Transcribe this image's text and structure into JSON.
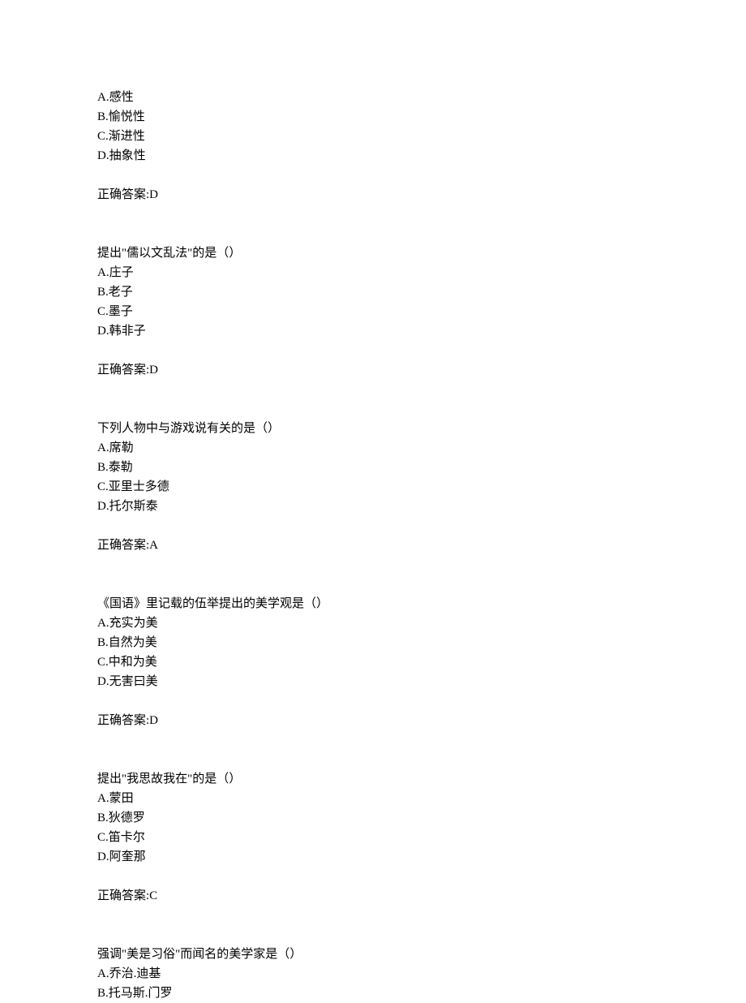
{
  "questions": [
    {
      "prompt": "",
      "options": [
        "A.感性",
        "B.愉悦性",
        "C.渐进性",
        "D.抽象性"
      ],
      "answer": "正确答案:D"
    },
    {
      "prompt": "提出\"儒以文乱法\"的是（）",
      "options": [
        "A.庄子",
        "B.老子",
        "C.墨子",
        "D.韩非子"
      ],
      "answer": "正确答案:D"
    },
    {
      "prompt": "下列人物中与游戏说有关的是（）",
      "options": [
        "A.席勒",
        "B.泰勒",
        "C.亚里士多德",
        "D.托尔斯泰"
      ],
      "answer": "正确答案:A"
    },
    {
      "prompt": "《国语》里记载的伍举提出的美学观是（）",
      "options": [
        "A.充实为美",
        "B.自然为美",
        "C.中和为美",
        "D.无害曰美"
      ],
      "answer": "正确答案:D"
    },
    {
      "prompt": "提出\"我思故我在\"的是（）",
      "options": [
        "A.蒙田",
        "B.狄德罗",
        "C.笛卡尔",
        "D.阿奎那"
      ],
      "answer": "正确答案:C"
    },
    {
      "prompt": "强调\"美是习俗\"而闻名的美学家是（）",
      "options": [
        "A.乔治.迪基",
        "B.托马斯.门罗"
      ],
      "answer": ""
    }
  ]
}
